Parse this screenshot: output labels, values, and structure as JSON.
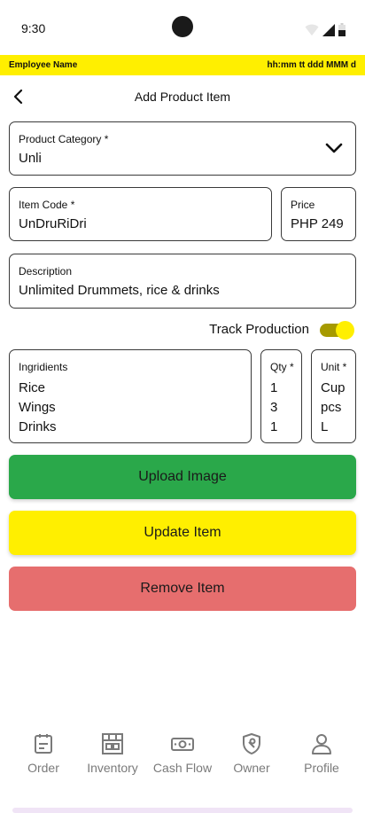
{
  "status_bar": {
    "time": "9:30"
  },
  "employee_bar": {
    "name": "Employee Name",
    "datetime": "hh:mm tt ddd MMM d"
  },
  "header": {
    "title": "Add Product Item"
  },
  "form": {
    "category": {
      "label": "Product Category *",
      "value": "Unli"
    },
    "item_code": {
      "label": "Item Code *",
      "value": "UnDruRiDri"
    },
    "price": {
      "label": "Price",
      "value": "PHP 249"
    },
    "description": {
      "label": "Description",
      "value": "Unlimited Drummets, rice & drinks"
    },
    "track_production": {
      "label": "Track Production",
      "enabled": true
    },
    "ingredients": {
      "label": "Ingridients",
      "items": [
        "Rice",
        "Wings",
        "Drinks"
      ]
    },
    "qty": {
      "label": "Qty *",
      "items": [
        "1",
        "3",
        "1"
      ]
    },
    "unit": {
      "label": "Unit *",
      "items": [
        "Cup",
        "pcs",
        "L"
      ]
    }
  },
  "buttons": {
    "upload": {
      "label": "Upload Image",
      "color": "#2aa84a"
    },
    "update": {
      "label": "Update Item",
      "color": "#ffef00"
    },
    "remove": {
      "label": "Remove Item",
      "color": "#e66e6e"
    }
  },
  "bottom_nav": {
    "items": [
      {
        "label": "Order",
        "icon": "order-icon"
      },
      {
        "label": "Inventory",
        "icon": "inventory-icon"
      },
      {
        "label": "Cash Flow",
        "icon": "cash-flow-icon"
      },
      {
        "label": "Owner",
        "icon": "owner-icon"
      },
      {
        "label": "Profile",
        "icon": "profile-icon"
      }
    ]
  },
  "colors": {
    "accent_yellow": "#ffef00",
    "toggle_track": "#a69a00",
    "nav_gray": "#7a7a7a"
  }
}
